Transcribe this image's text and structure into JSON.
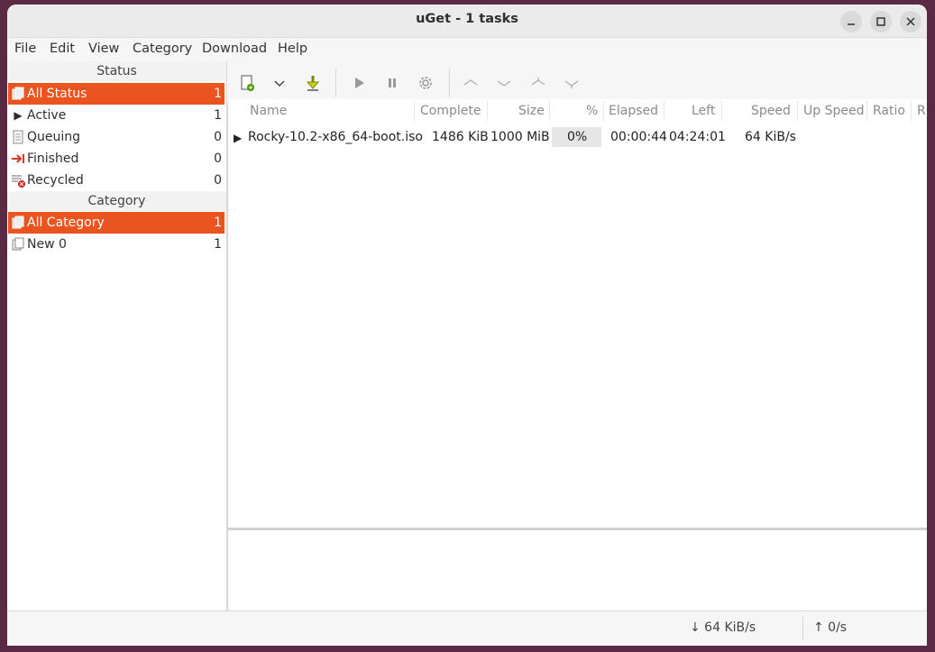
{
  "window": {
    "title": "uGet - 1 tasks"
  },
  "menu": [
    "File",
    "Edit",
    "View",
    "Category",
    "Download",
    "Help"
  ],
  "sidebar": {
    "status_header": "Status",
    "status_items": [
      {
        "label": "All Status",
        "count": "1",
        "icon": "all-status-icon"
      },
      {
        "label": "Active",
        "count": "1",
        "icon": "play-icon"
      },
      {
        "label": "Queuing",
        "count": "0",
        "icon": "document-icon"
      },
      {
        "label": "Finished",
        "count": "0",
        "icon": "finished-arrow-icon"
      },
      {
        "label": "Recycled",
        "count": "0",
        "icon": "recycled-icon"
      }
    ],
    "category_header": "Category",
    "category_items": [
      {
        "label": "All Category",
        "count": "1",
        "icon": "all-category-icon"
      },
      {
        "label": "New 0",
        "count": "1",
        "icon": "category-icon"
      }
    ]
  },
  "toolbar": {
    "buttons": [
      "new-download",
      "new-dropdown",
      "save-download",
      "start",
      "pause",
      "properties",
      "move-up",
      "move-down",
      "move-top",
      "move-bottom"
    ]
  },
  "table": {
    "columns": [
      "Name",
      "Complete",
      "Size",
      "%",
      "Elapsed",
      "Left",
      "Speed",
      "Up Speed",
      "Ratio",
      "R"
    ],
    "rows": [
      {
        "name": "Rocky-10.2-x86_64-boot.iso",
        "complete": "1486 KiB",
        "size": "1000 MiB",
        "percent": "0%",
        "progress": 0.0,
        "elapsed": "00:00:44",
        "left": "04:24:01",
        "speed": "64 KiB/s"
      }
    ]
  },
  "statusbar": {
    "down_speed": "↓ 64 KiB/s",
    "up_speed": "↑ 0/s"
  },
  "colors": {
    "selection": "#e95420",
    "desktop": "#5a2a45"
  }
}
